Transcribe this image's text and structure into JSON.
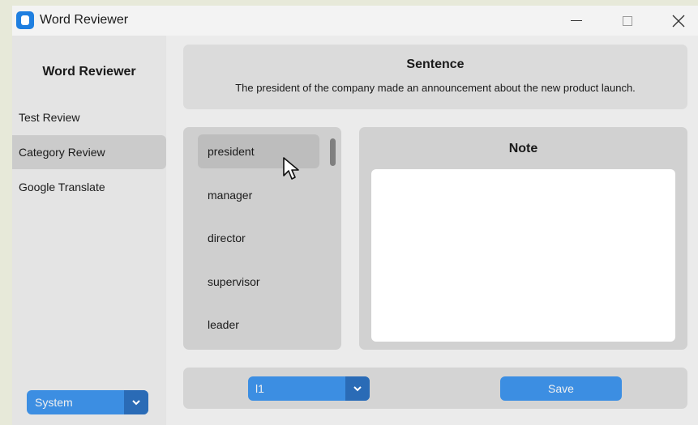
{
  "window": {
    "title": "Word Reviewer"
  },
  "sidebar": {
    "title": "Word Reviewer",
    "items": [
      {
        "label": "Test Review",
        "active": false
      },
      {
        "label": "Category Review",
        "active": true
      },
      {
        "label": "Google Translate",
        "active": false
      }
    ],
    "appearance_select": {
      "value": "System"
    }
  },
  "sentence": {
    "title": "Sentence",
    "text": "The president of the company made an announcement about the new product launch."
  },
  "word_list": {
    "items": [
      "president",
      "manager",
      "director",
      "supervisor",
      "leader"
    ],
    "selected": "president"
  },
  "note": {
    "title": "Note",
    "value": ""
  },
  "bottom": {
    "category_select": {
      "value": "l1"
    },
    "save_label": "Save"
  },
  "colors": {
    "accent": "#3c8ee2",
    "accent_dark": "#2a6bb6"
  }
}
